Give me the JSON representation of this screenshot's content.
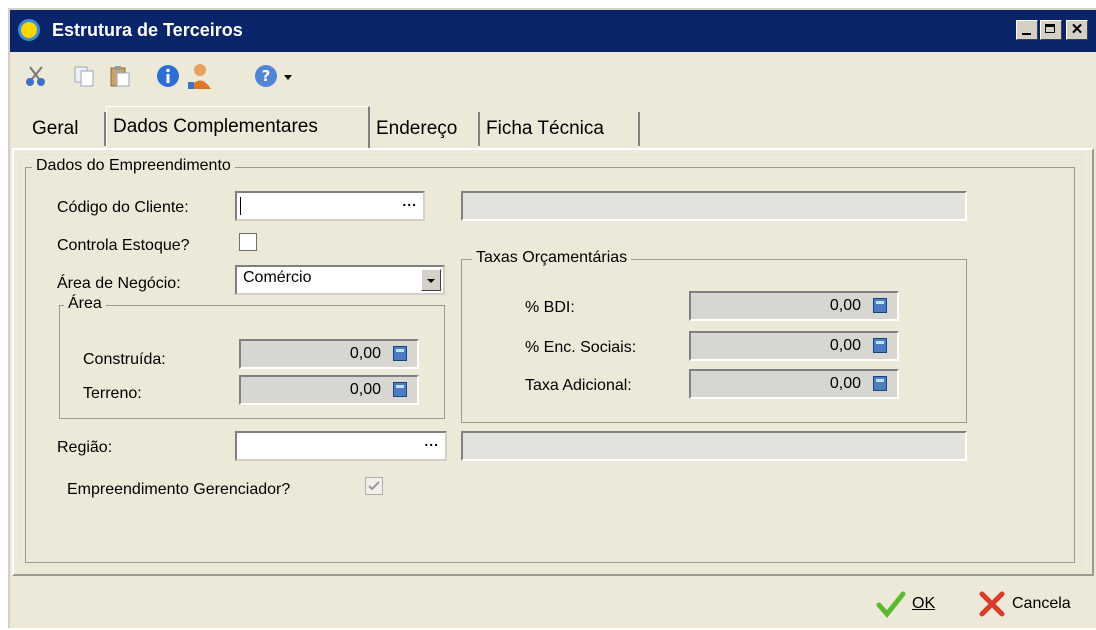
{
  "window": {
    "title": "Estrutura de Terceiros"
  },
  "toolbar": {
    "icons": [
      "cut-icon",
      "copy-icon",
      "paste-icon",
      "info-icon",
      "user-icon",
      "help-icon",
      "dropdown-arrow-icon"
    ]
  },
  "tabs": [
    {
      "label": "Geral",
      "active": false
    },
    {
      "label": "Dados Complementares",
      "active": true
    },
    {
      "label": "Endereço",
      "active": false
    },
    {
      "label": "Ficha Técnica",
      "active": false
    }
  ],
  "dados": {
    "legend": "Dados do Empreendimento",
    "codigo_cliente_label": "Código do Cliente:",
    "codigo_cliente_value": "",
    "codigo_cliente_desc": "",
    "controla_estoque_label": "Controla Estoque?",
    "controla_estoque_checked": false,
    "area_negocio_label": "Área de Negócio:",
    "area_negocio_value": "Comércio",
    "area": {
      "legend": "Área",
      "construida_label": "Construída:",
      "construida_value": "0,00",
      "terreno_label": "Terreno:",
      "terreno_value": "0,00"
    },
    "taxas": {
      "legend": "Taxas Orçamentárias",
      "bdi_label": "% BDI:",
      "bdi_value": "0,00",
      "enc_label": "% Enc. Sociais:",
      "enc_value": "0,00",
      "adicional_label": "Taxa Adicional:",
      "adicional_value": "0,00"
    },
    "regiao_label": "Região:",
    "regiao_value": "",
    "regiao_desc": "",
    "gerenciador_label": "Empreendimento Gerenciador?",
    "gerenciador_checked": true,
    "ellipsis": "..."
  },
  "footer": {
    "ok_label": "OK",
    "cancel_label": "Cancela"
  },
  "colors": {
    "titlebar": "#0a246a",
    "ok_check": "#5cb82e",
    "cancel_x": "#d93a2b"
  }
}
